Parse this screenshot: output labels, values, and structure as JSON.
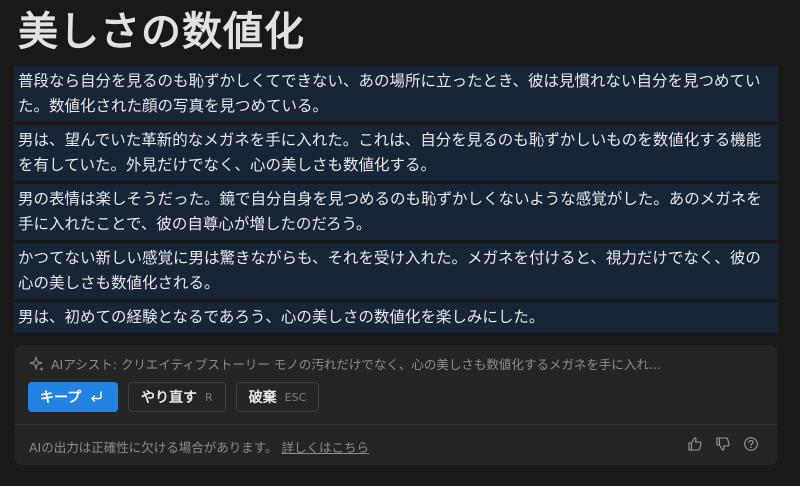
{
  "page": {
    "title": "美しさの数値化"
  },
  "paragraphs": [
    "普段なら自分を見るのも恥ずかしくてできない、あの場所に立ったとき、彼は見慣れない自分を見つめていた。数値化された顔の写真を見つめている。",
    "男は、望んでいた革新的なメガネを手に入れた。これは、自分を見るのも恥ずかしいものを数値化する機能を有していた。外見だけでなく、心の美しさも数値化する。",
    "男の表情は楽しそうだった。鏡で自分自身を見つめるのも恥ずかしくないような感覚がした。あのメガネを手に入れたことで、彼の自尊心が増したのだろう。",
    "かつてない新しい感覚に男は驚きながらも、それを受け入れた。メガネを付けると、視力だけでなく、彼の心の美しさも数値化される。",
    "男は、初めての経験となるであろう、心の美しさの数値化を楽しみにした。"
  ],
  "assistant": {
    "prompt_text": "AIアシスト: クリエイティブストーリー モノの汚れだけでなく、心の美しさも数値化するメガネを手に入れ...",
    "buttons": {
      "keep_label": "キープ",
      "retry_label": "やり直す",
      "retry_key": "R",
      "discard_label": "破棄",
      "discard_key": "ESC"
    },
    "footer_text": "AIの出力は正確性に欠ける場合があります。",
    "footer_link": "詳しくはこちら"
  },
  "icons": {
    "sparkle": "sparkle-icon",
    "enter": "enter-icon",
    "thumbs_up": "thumbs-up-icon",
    "thumbs_down": "thumbs-down-icon",
    "help": "help-icon"
  },
  "colors": {
    "background": "#191919",
    "highlight": "#182536",
    "panel": "#252525",
    "primary": "#2383e2"
  }
}
